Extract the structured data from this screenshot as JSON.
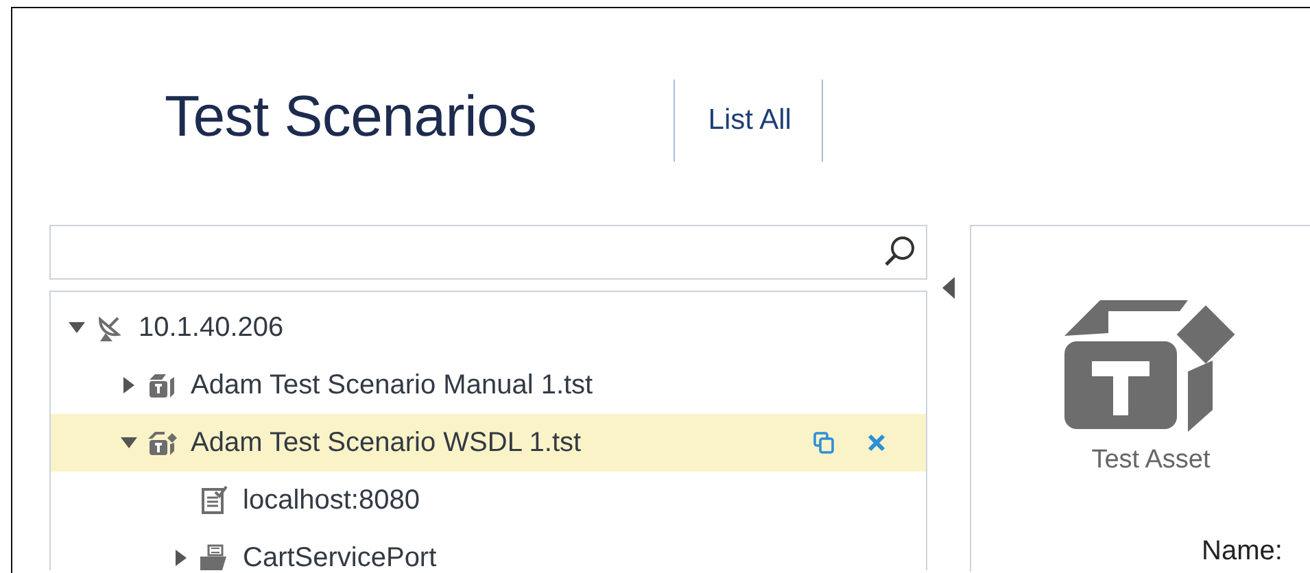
{
  "header": {
    "title": "Test Scenarios",
    "link": "List All"
  },
  "tree": [
    {
      "label": "10.1.40.206",
      "kind": "server",
      "expanded": true,
      "selected": false,
      "children": [
        {
          "label": "Adam Test Scenario Manual 1.tst",
          "kind": "asset",
          "expanded": false,
          "selected": false
        },
        {
          "label": "Adam Test Scenario WSDL 1.tst",
          "kind": "asset-open",
          "expanded": true,
          "selected": true,
          "children": [
            {
              "label": "localhost:8080",
              "kind": "endpoint",
              "selected": false
            },
            {
              "label": "CartServicePort",
              "kind": "port",
              "expanded": false,
              "selected": false
            }
          ]
        }
      ]
    }
  ],
  "details": {
    "asset_type": "Test Asset",
    "fields": [
      {
        "label": "Name:"
      }
    ]
  }
}
